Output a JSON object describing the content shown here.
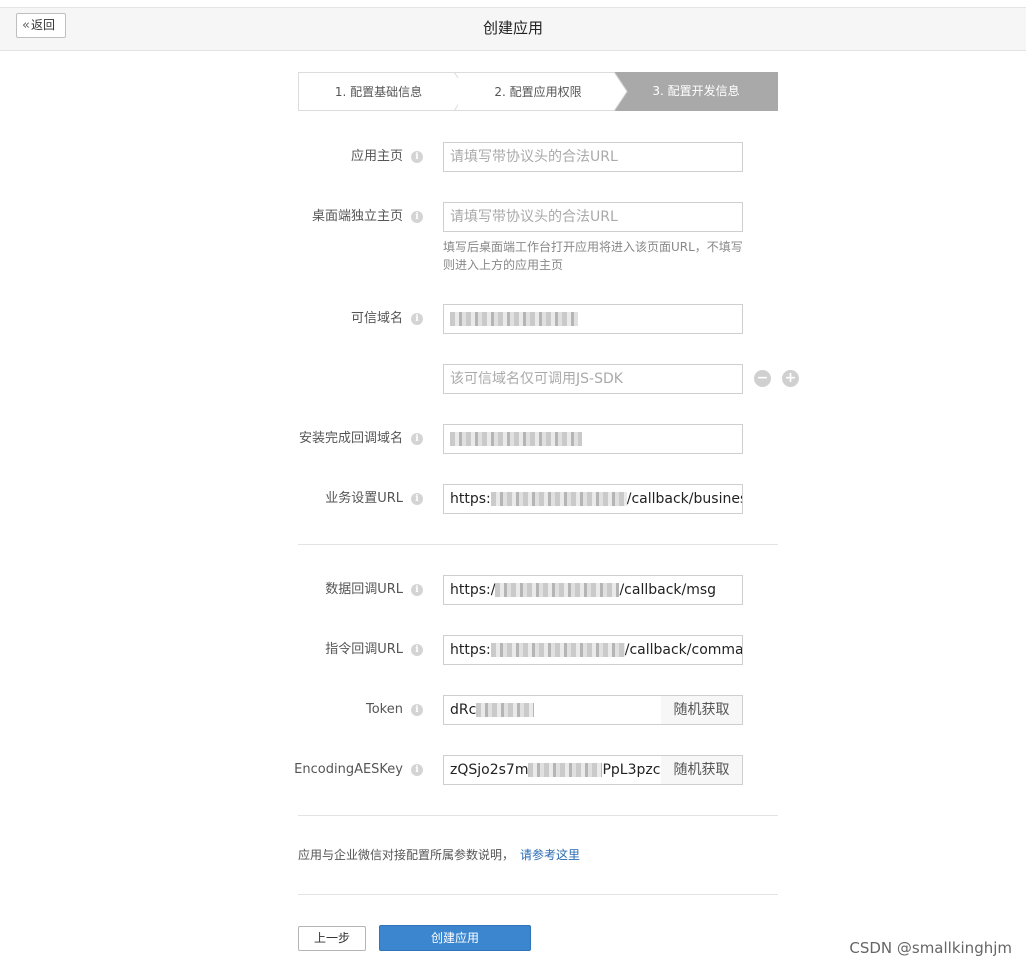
{
  "header": {
    "back_label": "返回",
    "title": "创建应用"
  },
  "steps": [
    {
      "label": "1. 配置基础信息"
    },
    {
      "label": "2. 配置应用权限"
    },
    {
      "label": "3. 配置开发信息"
    }
  ],
  "fields": {
    "homepage": {
      "label": "应用主页",
      "placeholder": "请填写带协议头的合法URL"
    },
    "desktop_homepage": {
      "label": "桌面端独立主页",
      "placeholder": "请填写带协议头的合法URL",
      "hint": "填写后桌面端工作台打开应用将进入该页面URL，不填写则进入上方的应用主页"
    },
    "trusted_domain": {
      "label": "可信域名",
      "extra_placeholder": "该可信域名仅可调用JS-SDK"
    },
    "install_callback_domain": {
      "label": "安装完成回调域名"
    },
    "business_url": {
      "label": "业务设置URL",
      "prefix": "https:",
      "suffix": "/callback/business"
    },
    "data_callback_url": {
      "label": "数据回调URL",
      "prefix": "https:/",
      "suffix": "/callback/msg"
    },
    "command_callback_url": {
      "label": "指令回调URL",
      "prefix": "https:",
      "suffix": "/callback/command"
    },
    "token": {
      "label": "Token",
      "prefix": "dRc",
      "button": "随机获取"
    },
    "aes_key": {
      "label": "EncodingAESKey",
      "prefix": "zQSjo2s7m",
      "suffix": "PpL3pzc",
      "button": "随机获取"
    }
  },
  "footer": {
    "note": "应用与企业微信对接配置所属参数说明，",
    "link": "请参考这里",
    "prev_label": "上一步",
    "create_label": "创建应用"
  },
  "watermark": "CSDN @smallkinghjm"
}
